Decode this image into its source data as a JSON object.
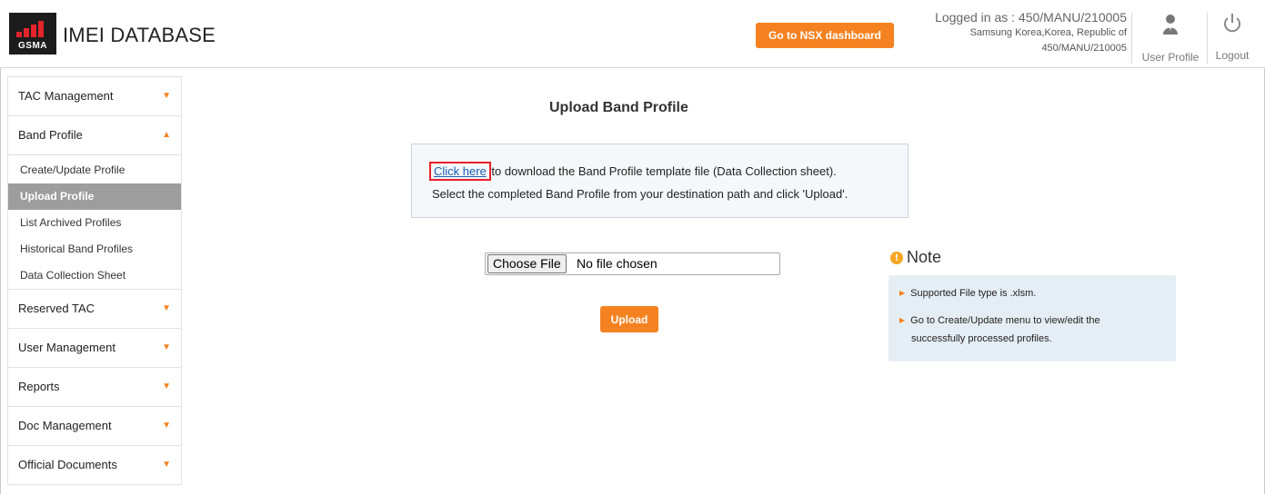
{
  "header": {
    "logo_text": "GSMA",
    "app_title": "IMEI DATABASE",
    "nsx_button": "Go to NSX dashboard",
    "login_line1": "Logged in as : 450/MANU/210005",
    "login_line2": "Samsung Korea,Korea, Republic of",
    "login_line3": "450/MANU/210005",
    "user_profile_label": "User Profile",
    "logout_label": "Logout",
    "accent_color": "#f58220"
  },
  "sidebar": {
    "items": [
      {
        "label": "TAC Management"
      },
      {
        "label": "Band Profile"
      },
      {
        "label": "Reserved TAC"
      },
      {
        "label": "User Management"
      },
      {
        "label": "Reports"
      },
      {
        "label": "Doc Management"
      },
      {
        "label": "Official Documents"
      }
    ],
    "band_profile_sub": [
      {
        "label": "Create/Update Profile"
      },
      {
        "label": "Upload Profile"
      },
      {
        "label": "List Archived Profiles"
      },
      {
        "label": "Historical Band Profiles"
      },
      {
        "label": "Data Collection Sheet"
      }
    ]
  },
  "main": {
    "title": "Upload Band Profile",
    "link_text": "Click here",
    "info_line1_rest": " to download the Band Profile template file (Data Collection sheet).",
    "info_line2": "Select the completed Band Profile from your destination path and click 'Upload'.",
    "choose_file_label": "Choose File",
    "file_status": "No file chosen",
    "upload_button": "Upload"
  },
  "note": {
    "title": "Note",
    "items": [
      "Supported File type is .xlsm.",
      "Go to Create/Update menu to view/edit the",
      "successfully processed profiles."
    ]
  }
}
